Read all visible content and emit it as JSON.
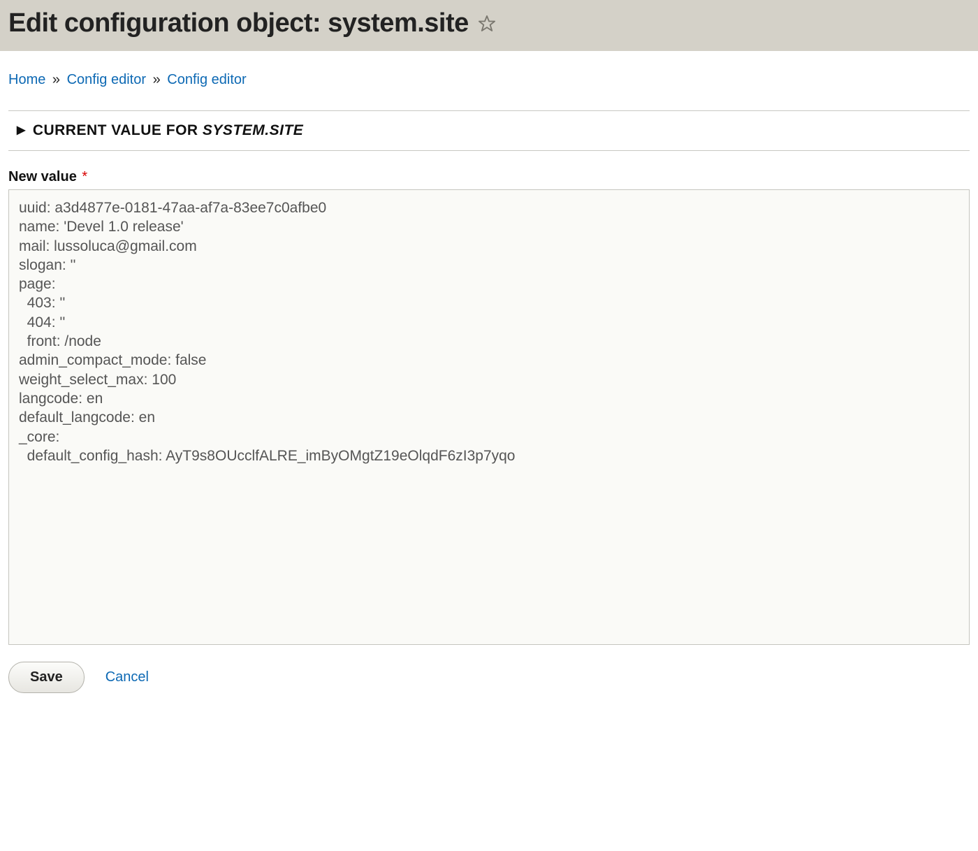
{
  "header": {
    "title": "Edit configuration object: system.site"
  },
  "breadcrumbs": {
    "items": [
      "Home",
      "Config editor",
      "Config editor"
    ],
    "separator": "»"
  },
  "details": {
    "summary_prefix": "CURRENT VALUE FOR ",
    "summary_object": "SYSTEM.SITE"
  },
  "form": {
    "new_value_label": "New value",
    "required_marker": "*",
    "textarea_value": "uuid: a3d4877e-0181-47aa-af7a-83ee7c0afbe0\nname: 'Devel 1.0 release'\nmail: lussoluca@gmail.com\nslogan: ''\npage:\n  403: ''\n  404: ''\n  front: /node\nadmin_compact_mode: false\nweight_select_max: 100\nlangcode: en\ndefault_langcode: en\n_core:\n  default_config_hash: AyT9s8OUcclfALRE_imByOMgtZ19eOlqdF6zI3p7yqo\n"
  },
  "actions": {
    "save_label": "Save",
    "cancel_label": "Cancel"
  }
}
